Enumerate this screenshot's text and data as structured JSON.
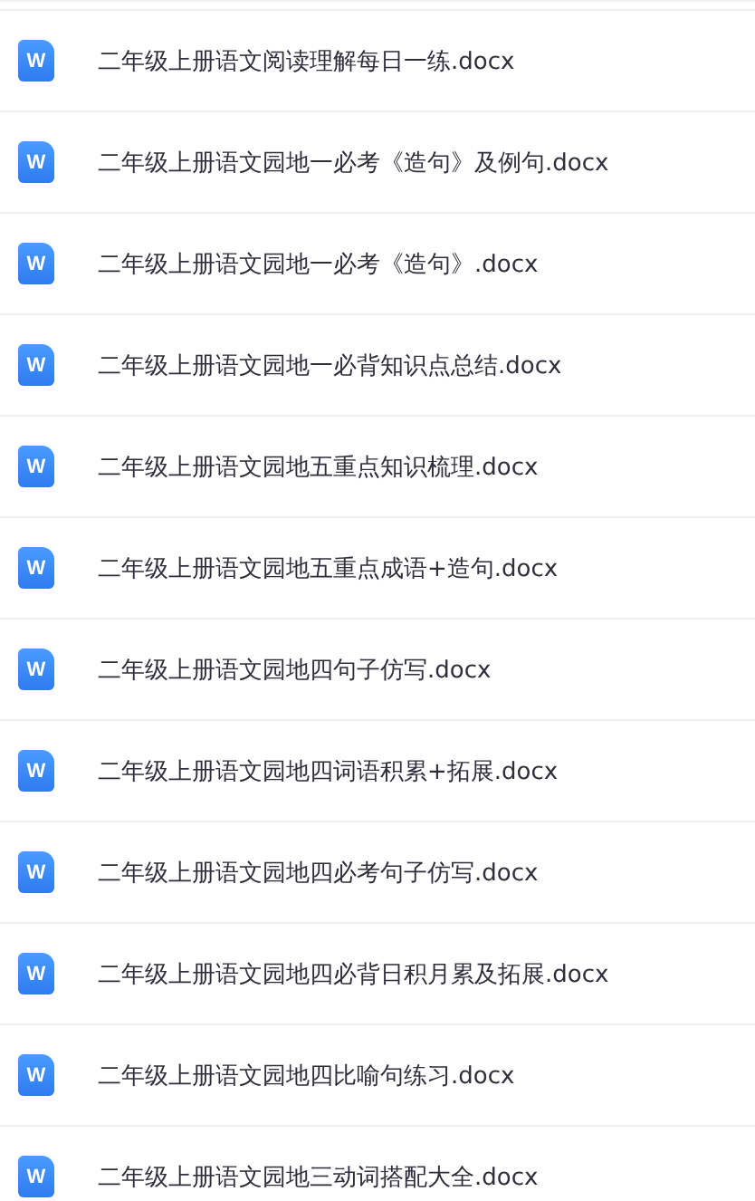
{
  "files": [
    {
      "name": "二年级上册语文阅读理解每日一练.docx",
      "icon_letter": "W"
    },
    {
      "name": "二年级上册语文园地一必考《造句》及例句.docx",
      "icon_letter": "W"
    },
    {
      "name": "二年级上册语文园地一必考《造句》.docx",
      "icon_letter": "W"
    },
    {
      "name": "二年级上册语文园地一必背知识点总结.docx",
      "icon_letter": "W"
    },
    {
      "name": "二年级上册语文园地五重点知识梳理.docx",
      "icon_letter": "W"
    },
    {
      "name": "二年级上册语文园地五重点成语+造句.docx",
      "icon_letter": "W"
    },
    {
      "name": "二年级上册语文园地四句子仿写.docx",
      "icon_letter": "W"
    },
    {
      "name": "二年级上册语文园地四词语积累+拓展.docx",
      "icon_letter": "W"
    },
    {
      "name": "二年级上册语文园地四必考句子仿写.docx",
      "icon_letter": "W"
    },
    {
      "name": "二年级上册语文园地四必背日积月累及拓展.docx",
      "icon_letter": "W"
    },
    {
      "name": "二年级上册语文园地四比喻句练习.docx",
      "icon_letter": "W"
    },
    {
      "name": "二年级上册语文园地三动词搭配大全.docx",
      "icon_letter": "W"
    }
  ]
}
